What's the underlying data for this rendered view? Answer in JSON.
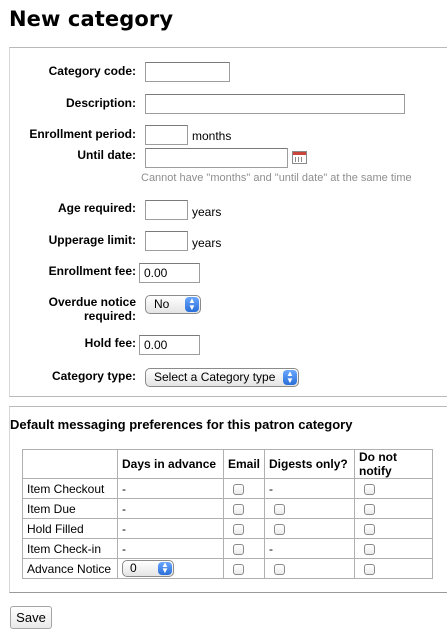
{
  "page": {
    "title": "New category"
  },
  "form": {
    "category_code": {
      "label": "Category code:",
      "value": ""
    },
    "description": {
      "label": "Description:",
      "value": ""
    },
    "enrollment_period": {
      "label": "Enrollment period:",
      "value": "",
      "unit": "months"
    },
    "until_date": {
      "label": "Until date:",
      "value": "",
      "hint": "Cannot have \"months\" and \"until date\" at the same time"
    },
    "age_required": {
      "label": "Age required:",
      "value": "",
      "unit": "years"
    },
    "upperage_limit": {
      "label": "Upperage limit:",
      "value": "",
      "unit": "years"
    },
    "enrollment_fee": {
      "label": "Enrollment fee:",
      "value": "0.00"
    },
    "overdue_notice": {
      "label_line1": "Overdue notice",
      "label_line2": "required:",
      "selected": "No"
    },
    "hold_fee": {
      "label": "Hold fee:",
      "value": "0.00"
    },
    "category_type": {
      "label": "Category type:",
      "selected": "Select a Category type"
    }
  },
  "messaging": {
    "title": "Default messaging preferences for this patron category",
    "headers": [
      "",
      "Days in advance",
      "Email",
      "Digests only?",
      "Do not notify"
    ],
    "rows": [
      {
        "name": "Item Checkout",
        "days": "-",
        "digest": "-"
      },
      {
        "name": "Item Due",
        "days": "-",
        "digest": ""
      },
      {
        "name": "Hold Filled",
        "days": "-",
        "digest": ""
      },
      {
        "name": "Item Check-in",
        "days": "-",
        "digest": "-"
      },
      {
        "name": "Advance Notice",
        "days_select": "0",
        "digest": ""
      }
    ]
  },
  "actions": {
    "save_label": "Save"
  }
}
